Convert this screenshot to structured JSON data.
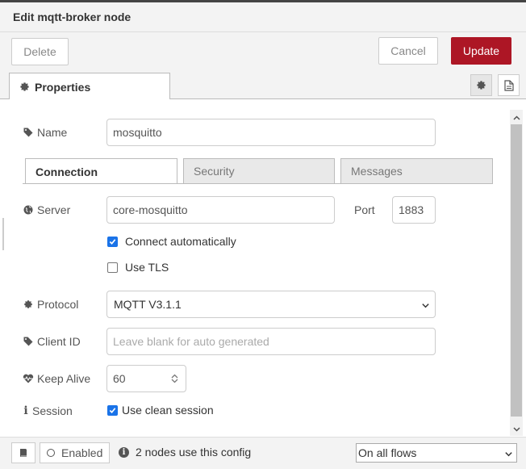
{
  "header": {
    "title": "Edit mqtt-broker node"
  },
  "toolbar": {
    "delete_label": "Delete",
    "cancel_label": "Cancel",
    "update_label": "Update",
    "accent": "#ad1625"
  },
  "tabs": {
    "properties_label": "Properties"
  },
  "fields": {
    "name": {
      "label": "Name",
      "value": "mosquitto"
    },
    "server": {
      "label": "Server",
      "value": "core-mosquitto"
    },
    "port": {
      "label": "Port",
      "value": "1883"
    },
    "connect_auto": {
      "label": "Connect automatically",
      "checked": true
    },
    "use_tls": {
      "label": "Use TLS",
      "checked": false
    },
    "protocol": {
      "label": "Protocol",
      "value": "MQTT V3.1.1"
    },
    "client_id": {
      "label": "Client ID",
      "placeholder": "Leave blank for auto generated",
      "value": ""
    },
    "keep_alive": {
      "label": "Keep Alive",
      "value": "60"
    },
    "session": {
      "label": "Session",
      "checkbox_label": "Use clean session",
      "checked": true
    }
  },
  "subtabs": [
    {
      "label": "Connection",
      "active": true
    },
    {
      "label": "Security",
      "active": false
    },
    {
      "label": "Messages",
      "active": false
    }
  ],
  "footer": {
    "enabled_label": "Enabled",
    "info_text": "2 nodes use this config",
    "scope_value": "On all flows"
  },
  "icons": [
    "gear-icon",
    "document-icon",
    "tag-icon",
    "globe-icon",
    "heartbeat-icon",
    "info-icon",
    "book-icon",
    "chevron-down-icon"
  ]
}
